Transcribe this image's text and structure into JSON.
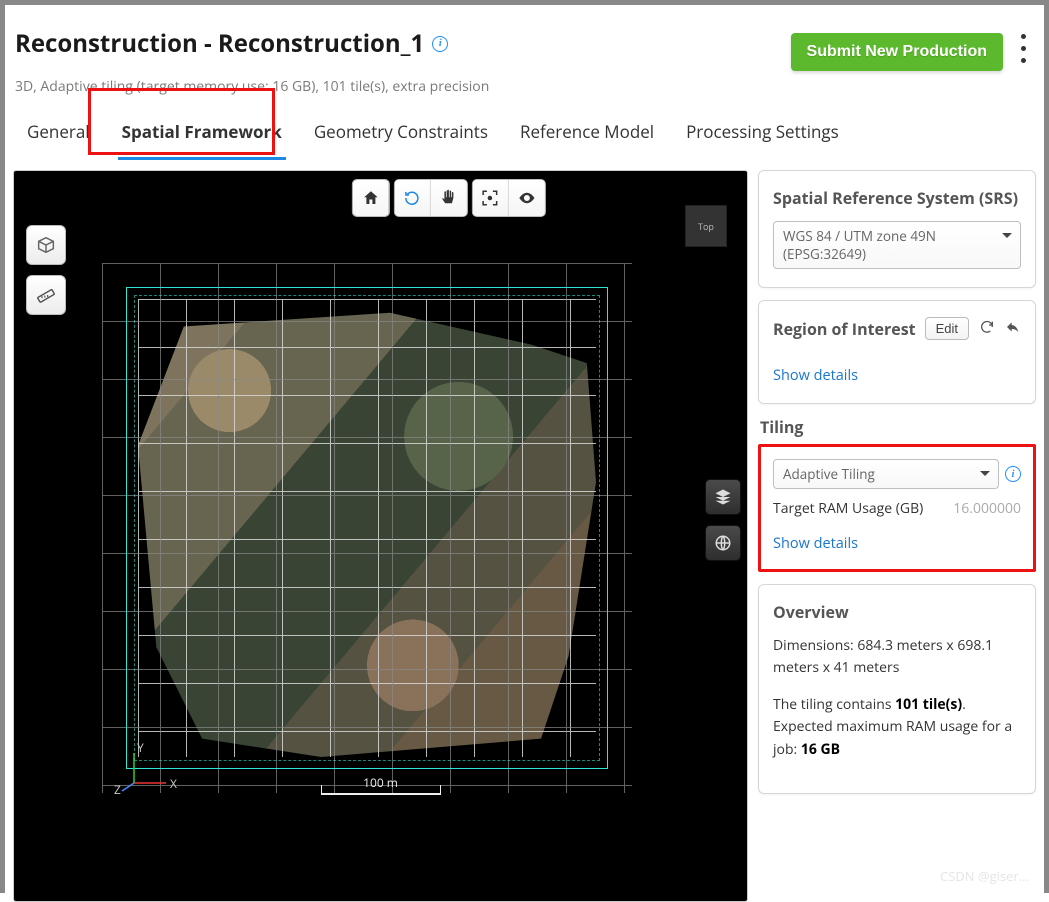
{
  "header": {
    "title": "Reconstruction - Reconstruction_1",
    "subtitle": "3D, Adaptive tiling (target memory use: 16 GB), 101 tile(s), extra precision",
    "submit_label": "Submit New Production"
  },
  "tabs": {
    "items": [
      {
        "label": "General"
      },
      {
        "label": "Spatial Framework"
      },
      {
        "label": "Geometry Constraints"
      },
      {
        "label": "Reference Model"
      },
      {
        "label": "Processing Settings"
      }
    ],
    "active_index": 1
  },
  "viewport": {
    "orientation_label": "Top",
    "scale_label": "100 m",
    "axes": {
      "x": "X",
      "y": "Y",
      "z": "Z"
    }
  },
  "srs": {
    "heading": "Spatial Reference System (SRS)",
    "value": "WGS 84 / UTM zone 49N (EPSG:32649)"
  },
  "roi": {
    "heading": "Region of Interest",
    "edit_label": "Edit",
    "show_details": "Show details"
  },
  "tiling": {
    "heading": "Tiling",
    "mode": "Adaptive Tiling",
    "ram_label": "Target RAM Usage (GB)",
    "ram_value": "16.000000",
    "show_details": "Show details"
  },
  "overview": {
    "heading": "Overview",
    "dimensions_prefix": "Dimensions: ",
    "dimensions_value": "684.3 meters x 698.1 meters x 41 meters",
    "tiling_prefix": "The tiling contains ",
    "tile_count": "101 tile(s)",
    "tiling_suffix": ".",
    "ram_line": "Expected maximum RAM usage for a job: ",
    "ram_value": "16 GB"
  }
}
